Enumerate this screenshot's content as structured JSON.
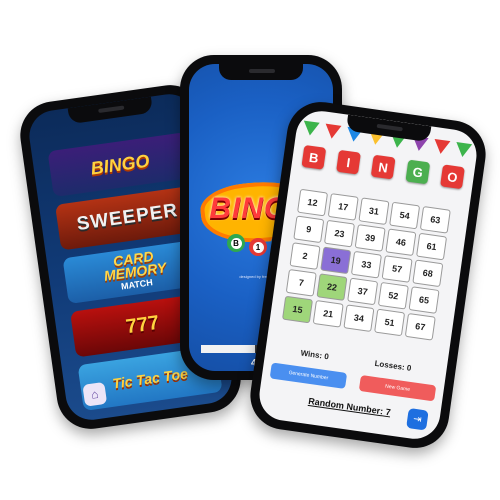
{
  "menu_screen": {
    "games": [
      {
        "label": "BINGO"
      },
      {
        "label": "SWEEPER"
      },
      {
        "label": "CARD",
        "label2": "MEMORY",
        "sub": "MATCH"
      },
      {
        "label": "777"
      },
      {
        "label": "Tic Tac Toe"
      }
    ],
    "home_icon": "⌂"
  },
  "splash_screen": {
    "logo": "BINGO",
    "balls": [
      "B",
      "1",
      "12",
      "7"
    ],
    "credit": "designed by freepik.com",
    "progress": 0.45,
    "progress_label": "45%"
  },
  "game_screen": {
    "title_tiles": [
      {
        "letter": "B",
        "color": "#e53935"
      },
      {
        "letter": "I",
        "color": "#e53935"
      },
      {
        "letter": "N",
        "color": "#e53935"
      },
      {
        "letter": "G",
        "color": "#4caf50"
      },
      {
        "letter": "O",
        "color": "#e53935"
      }
    ],
    "board": [
      {
        "n": "12",
        "state": ""
      },
      {
        "n": "17",
        "state": ""
      },
      {
        "n": "31",
        "state": ""
      },
      {
        "n": "54",
        "state": ""
      },
      {
        "n": "63",
        "state": ""
      },
      {
        "n": "9",
        "state": ""
      },
      {
        "n": "23",
        "state": ""
      },
      {
        "n": "39",
        "state": ""
      },
      {
        "n": "46",
        "state": ""
      },
      {
        "n": "61",
        "state": ""
      },
      {
        "n": "2",
        "state": ""
      },
      {
        "n": "19",
        "state": "purple"
      },
      {
        "n": "33",
        "state": ""
      },
      {
        "n": "57",
        "state": ""
      },
      {
        "n": "68",
        "state": ""
      },
      {
        "n": "7",
        "state": ""
      },
      {
        "n": "22",
        "state": "green"
      },
      {
        "n": "37",
        "state": ""
      },
      {
        "n": "52",
        "state": ""
      },
      {
        "n": "65",
        "state": ""
      },
      {
        "n": "15",
        "state": "green"
      },
      {
        "n": "21",
        "state": ""
      },
      {
        "n": "34",
        "state": ""
      },
      {
        "n": "51",
        "state": ""
      },
      {
        "n": "67",
        "state": ""
      }
    ],
    "wins_label": "Wins: 0",
    "losses_label": "Losses: 0",
    "left_button": "Generate Number",
    "right_button": "New Game",
    "random_label": "Random Number: 7",
    "colors": {
      "purple": "#8a6fd6",
      "green": "#9fd67a",
      "blue_button": "#4a8ff0",
      "red_button": "#f05c5c"
    }
  }
}
